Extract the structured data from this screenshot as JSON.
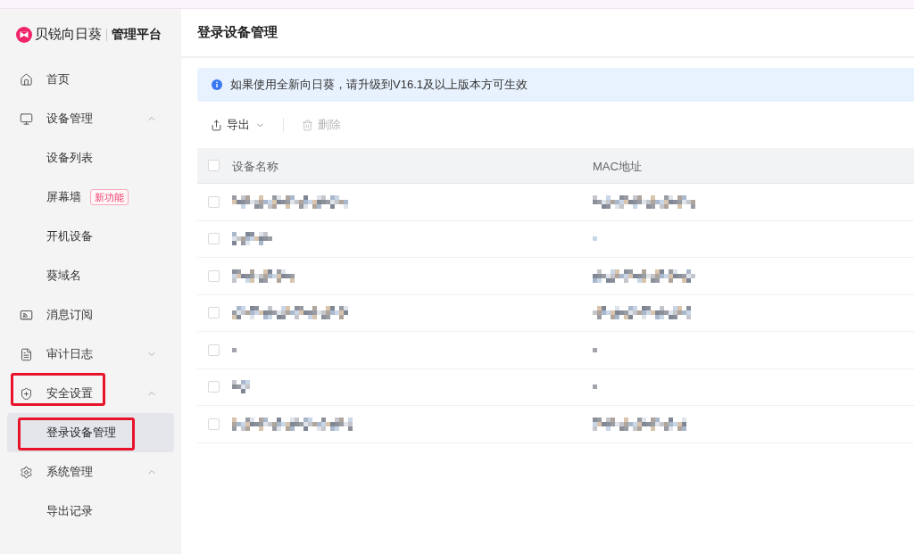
{
  "sidebar": {
    "logo": {
      "brand": "贝锐向日葵",
      "product": "管理平台"
    },
    "items": [
      {
        "kind": "link",
        "label": "首页",
        "selected": false,
        "outlined": false
      },
      {
        "kind": "group",
        "label": "设备管理",
        "selected": false,
        "outlined": false,
        "expanded": true,
        "children": [
          {
            "label": "设备列表",
            "selected": false,
            "outlined": false
          },
          {
            "label": "屏幕墙",
            "badge": "新功能",
            "selected": false,
            "outlined": false
          },
          {
            "label": "开机设备",
            "selected": false,
            "outlined": false
          },
          {
            "label": "葵域名",
            "selected": false,
            "outlined": false
          }
        ]
      },
      {
        "kind": "link",
        "label": "消息订阅",
        "selected": false,
        "outlined": false
      },
      {
        "kind": "group",
        "label": "审计日志",
        "selected": false,
        "outlined": false,
        "expanded": false
      },
      {
        "kind": "group",
        "label": "安全设置",
        "selected": false,
        "outlined": true,
        "expanded": true,
        "children": [
          {
            "label": "登录设备管理",
            "selected": true,
            "outlined": true
          }
        ]
      },
      {
        "kind": "group",
        "label": "系统管理",
        "selected": false,
        "outlined": false,
        "expanded": true,
        "children": [
          {
            "label": "导出记录",
            "selected": false,
            "outlined": false
          }
        ]
      }
    ]
  },
  "page": {
    "title": "登录设备管理"
  },
  "notice": {
    "text": "如果使用全新向日葵，请升级到V16.1及以上版本方可生效"
  },
  "toolbar": [
    {
      "kind": "dropdown",
      "label": "导出",
      "disabled": false
    },
    {
      "kind": "button",
      "label": "删除",
      "disabled": true
    }
  ],
  "table": {
    "select_all": {
      "checked": false
    },
    "columns": [
      {
        "label": "设备名称"
      },
      {
        "label": "MAC地址"
      }
    ],
    "rows": [
      {
        "checked": false
      },
      {
        "checked": false
      },
      {
        "checked": false
      },
      {
        "checked": false
      },
      {
        "checked": false
      },
      {
        "checked": false
      },
      {
        "checked": false
      }
    ]
  }
}
